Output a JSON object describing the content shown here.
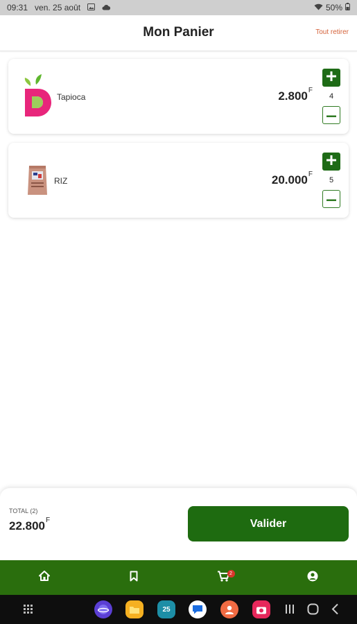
{
  "status_bar": {
    "time": "09:31",
    "date": "ven. 25 août",
    "battery": "50%"
  },
  "header": {
    "title": "Mon Panier",
    "clear_all": "Tout retirer"
  },
  "cart": {
    "items": [
      {
        "name": "Tapioca",
        "price": "2.800",
        "currency": "F",
        "quantity": "4",
        "icon": "tapioca-brand-logo"
      },
      {
        "name": "RIZ",
        "price": "20.000",
        "currency": "F",
        "quantity": "5",
        "icon": "rice-bag-image"
      }
    ]
  },
  "summary": {
    "total_label": "TOTAL (2)",
    "total_value": "22.800",
    "currency": "F",
    "validate_label": "Valider"
  },
  "tabbar": {
    "icons": [
      "home-icon",
      "bookmark-icon",
      "cart-icon",
      "account-icon"
    ],
    "cart_badge": "2"
  },
  "navbar": {
    "calendar_day": "25"
  },
  "colors": {
    "primary_green": "#1e6b10",
    "tabbar_green": "#2a6e0d",
    "accent_orange": "#d4623a",
    "badge_red": "#d9362b"
  }
}
